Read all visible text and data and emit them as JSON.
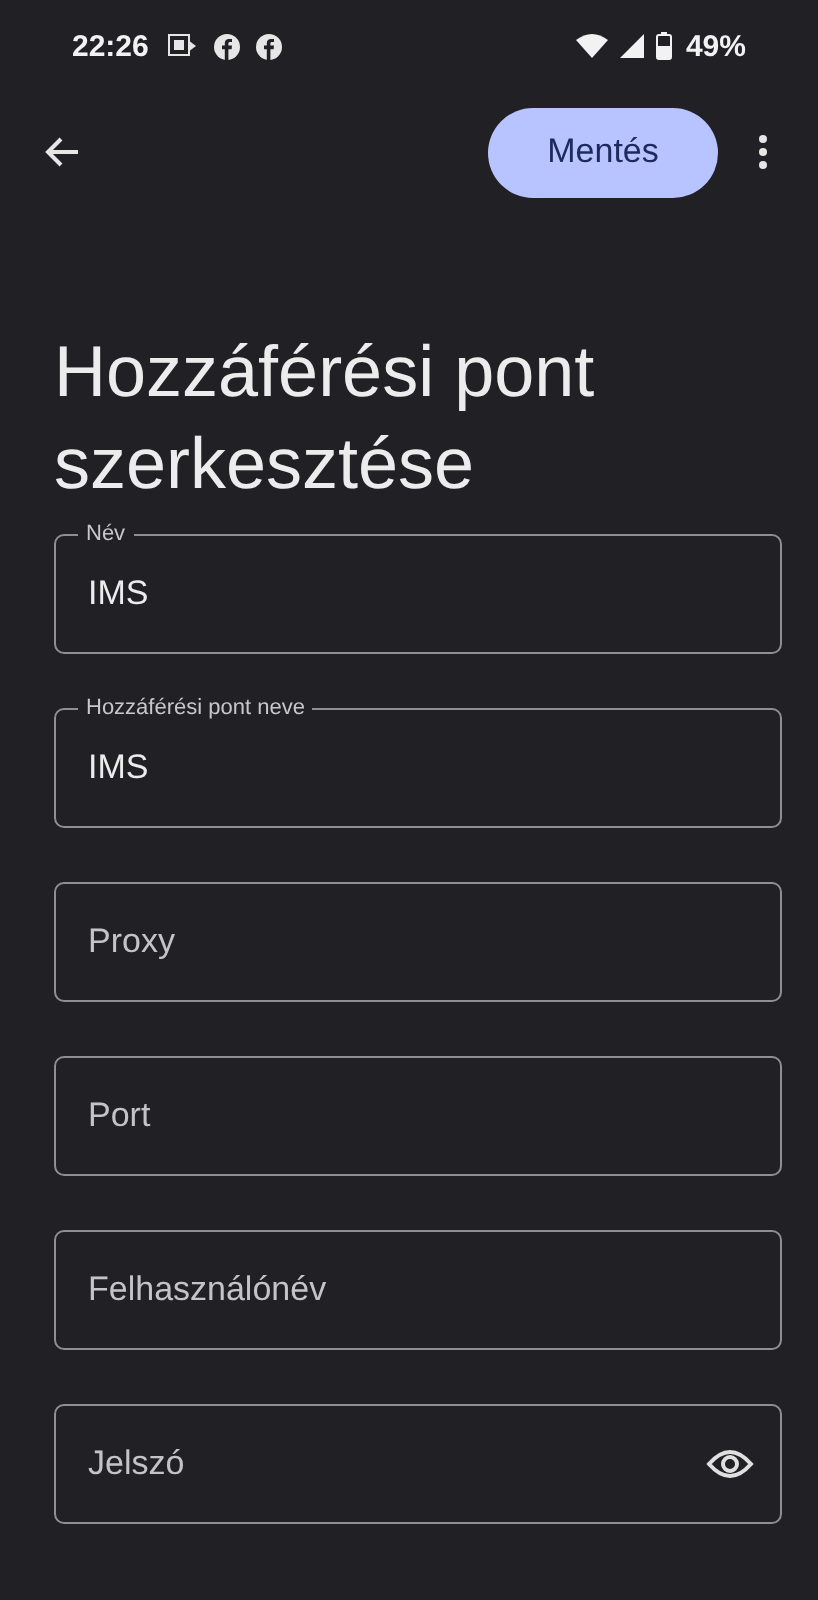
{
  "status_bar": {
    "time": "22:26",
    "battery": "49%"
  },
  "toolbar": {
    "save_button": "Mentés"
  },
  "title": "Hozzáférési pont szerkesztése",
  "fields": [
    {
      "kind": "text",
      "label": "Név",
      "value": "IMS"
    },
    {
      "kind": "text",
      "label": "Hozzáférési pont neve",
      "value": "IMS"
    },
    {
      "kind": "text",
      "placeholder": "Proxy"
    },
    {
      "kind": "text",
      "placeholder": "Port"
    },
    {
      "kind": "text",
      "placeholder": "Felhasználónév"
    },
    {
      "kind": "password",
      "placeholder": "Jelszó"
    }
  ]
}
